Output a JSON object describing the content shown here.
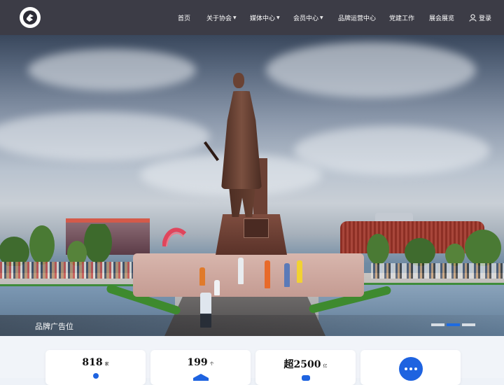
{
  "nav": {
    "items": [
      {
        "label": "首页",
        "has_dropdown": false
      },
      {
        "label": "关于协会",
        "has_dropdown": true
      },
      {
        "label": "媒体中心",
        "has_dropdown": true
      },
      {
        "label": "会员中心",
        "has_dropdown": true
      },
      {
        "label": "品牌运营中心",
        "has_dropdown": false
      },
      {
        "label": "党建工作",
        "has_dropdown": false
      },
      {
        "label": "展会展览",
        "has_dropdown": false
      }
    ],
    "login_label": "登录"
  },
  "banner": {
    "ad_label": "品牌广告位",
    "slide_count": 3,
    "active_slide": 2
  },
  "stats": [
    {
      "value": "818",
      "unit": "家"
    },
    {
      "value": "199",
      "unit": "个"
    },
    {
      "value": "超2500",
      "unit": "亿"
    },
    {
      "value": "",
      "unit": "",
      "icon": "chat-bubble-icon"
    }
  ],
  "colors": {
    "nav_bg": "#2c2c36",
    "accent": "#1e63e0"
  }
}
